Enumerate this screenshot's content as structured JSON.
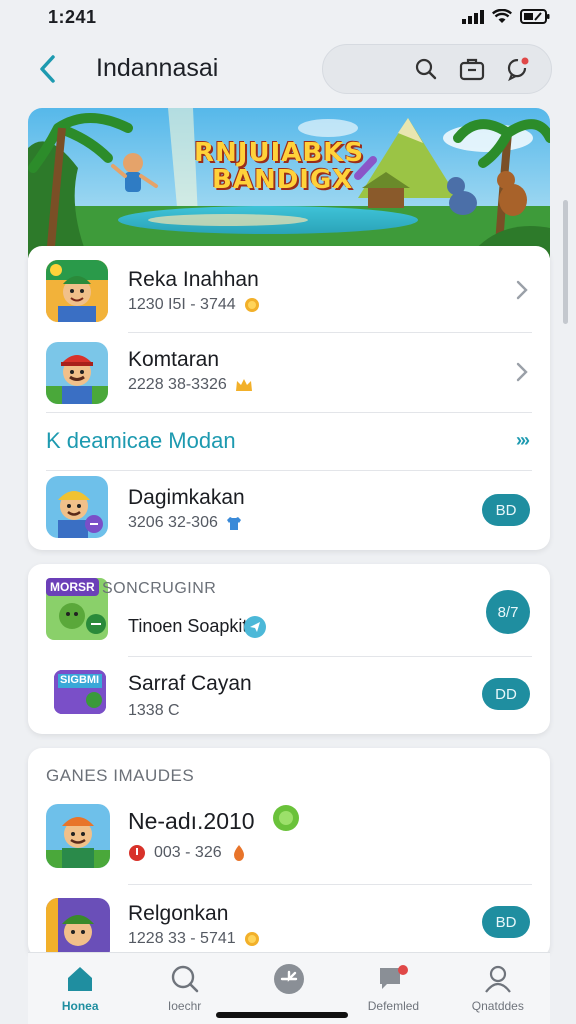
{
  "status_bar": {
    "time": "1:241"
  },
  "header": {
    "title": "Indannasai"
  },
  "hero": {
    "title_line1": "RNJUIABKS",
    "title_line2": "BANDIGX"
  },
  "card1": {
    "rows": [
      {
        "name": "Reka Inahhan",
        "meta": "1230 I5I - 3744"
      },
      {
        "name": "Komtaran",
        "meta": "2228 38-3326"
      }
    ],
    "section_link": "K deamicae Modan",
    "row3": {
      "name": "Dagimkakan",
      "meta": "3206 32-306",
      "button": "BD"
    }
  },
  "card2": {
    "tag": "MORSR",
    "header": "SONCRUGINR",
    "row1": {
      "name": "Tinoen Soapkit",
      "button": "8/7"
    },
    "row2": {
      "name": "Sarraf Cayan",
      "meta": "1338 C",
      "button": "DD",
      "icon_text": "SIGBMI"
    }
  },
  "card3": {
    "header": "GANES IMAUDES",
    "row1": {
      "name": "Ne-adı.2010",
      "meta": "003 - 326"
    },
    "row2": {
      "name": "Relgonkan",
      "meta": "1228 33 - 5741",
      "button": "BD"
    }
  },
  "bottom_nav": [
    {
      "label": "Honea",
      "icon": "home-icon",
      "active": true
    },
    {
      "label": "Ioechr",
      "icon": "search-icon",
      "active": false
    },
    {
      "label": "",
      "icon": "compass-icon",
      "active": false
    },
    {
      "label": "Defemled",
      "icon": "chat-icon",
      "active": false
    },
    {
      "label": "Qnatddes",
      "icon": "profile-icon",
      "active": false
    }
  ],
  "colors": {
    "accent": "#1f8ea0",
    "link": "#1d9ab0",
    "background": "#eef0f3"
  }
}
